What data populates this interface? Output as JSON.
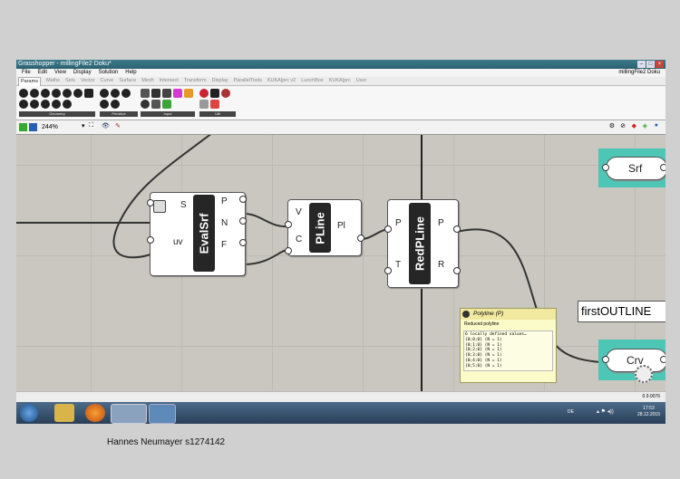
{
  "window": {
    "title": "Grasshopper - millingFile2 Doku*"
  },
  "menubar": {
    "items": [
      "File",
      "Edit",
      "View",
      "Display",
      "Solution",
      "Help"
    ],
    "doc_name": "millingFile2 Doku"
  },
  "tabs": [
    "Params",
    "Maths",
    "Sets",
    "Vector",
    "Curve",
    "Surface",
    "Mesh",
    "Intersect",
    "Transform",
    "Display",
    "ParallelTools",
    "KUKA|prc v2",
    "LunchBox",
    "KUKA|prc",
    "User"
  ],
  "ribbon_groups": [
    "Geometry",
    "Primitive",
    "Input",
    "Util"
  ],
  "canvas_toolbar": {
    "zoom": "244%"
  },
  "components": {
    "evalsrf": {
      "nickname": "EvalSrf",
      "inputs": [
        "S",
        "uv"
      ],
      "outputs": [
        "P",
        "N",
        "F"
      ]
    },
    "pline": {
      "nickname": "PLine",
      "inputs": [
        "V",
        "C"
      ],
      "outputs": [
        "Pl"
      ]
    },
    "redpline": {
      "nickname": "RedPLine",
      "inputs": [
        "P",
        "T"
      ],
      "outputs": [
        "P",
        "R"
      ]
    },
    "srf": {
      "label": "Srf"
    },
    "crv": {
      "label": "Crv",
      "group_label": "firstOUTLINE"
    }
  },
  "tooltip": {
    "title": "Polyline (P)",
    "desc": "Reduced polyline",
    "values": [
      "6 locally defined values…",
      "{0;0;0} (N = 1)",
      "{0;1;0} (N = 1)",
      "{0;2;0} (N = 1)",
      "{0;3;0} (N = 1)",
      "{0;4;0} (N = 1)",
      "{0;5;0} (N = 1)"
    ]
  },
  "status": {
    "version": "0.9.0076"
  },
  "taskbar": {
    "lang": "DE",
    "time": "17:53",
    "date": "28.12.2015"
  },
  "caption": "Hannes Neumayer s1274142"
}
